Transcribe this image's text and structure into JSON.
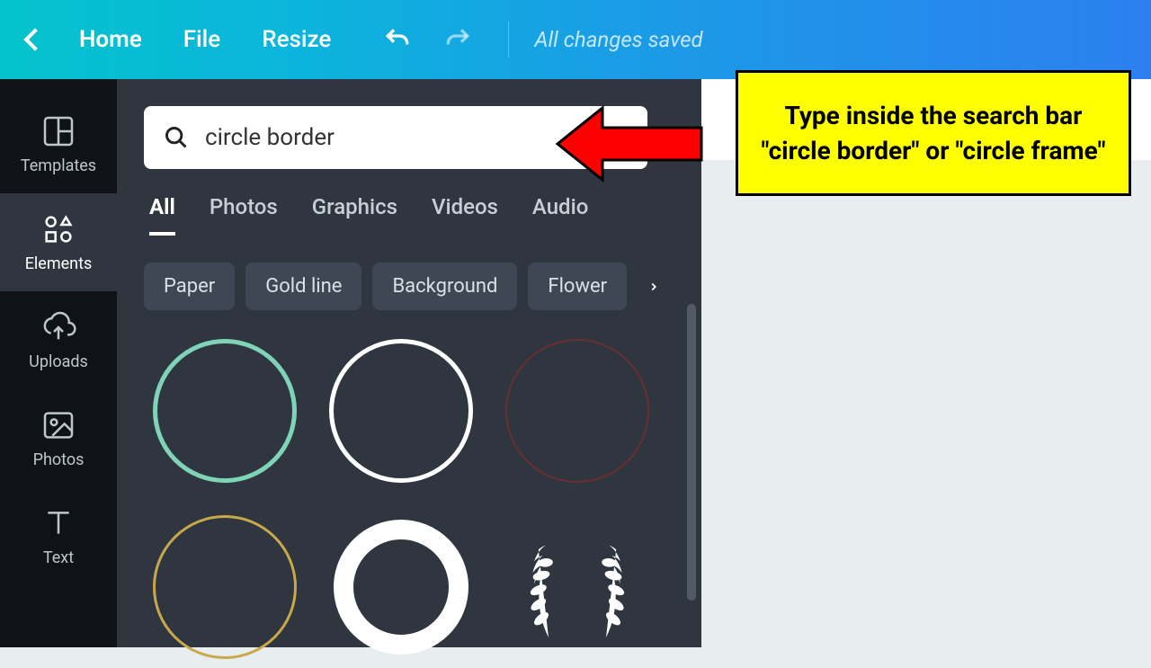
{
  "topbar": {
    "home": "Home",
    "file": "File",
    "resize": "Resize",
    "saved": "All changes saved"
  },
  "sidebar": {
    "items": [
      {
        "label": "Templates"
      },
      {
        "label": "Elements"
      },
      {
        "label": "Uploads"
      },
      {
        "label": "Photos"
      },
      {
        "label": "Text"
      }
    ]
  },
  "search": {
    "value": "circle border"
  },
  "tabs": [
    {
      "label": "All",
      "active": true
    },
    {
      "label": "Photos"
    },
    {
      "label": "Graphics"
    },
    {
      "label": "Videos"
    },
    {
      "label": "Audio"
    }
  ],
  "chips": [
    "Paper",
    "Gold line",
    "Background",
    "Flower"
  ],
  "callout": {
    "text": "Type inside the search bar \"circle border\" or \"circle frame\""
  }
}
